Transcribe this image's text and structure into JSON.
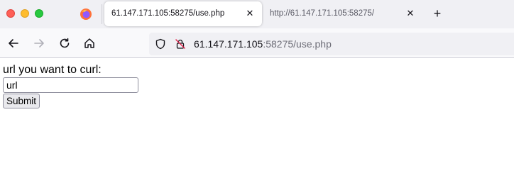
{
  "browser": {
    "tabs": [
      {
        "title": "61.147.171.105:58275/use.php",
        "active": true
      },
      {
        "title": "http://61.147.171.105:58275/",
        "active": false
      }
    ],
    "new_tab_label": "+",
    "close_label": "✕",
    "address": {
      "host": "61.147.171.105",
      "rest": ":58275/use.php"
    }
  },
  "page": {
    "prompt": "url you want to curl:",
    "input_value": "url",
    "submit_label": "Submit"
  },
  "colors": {
    "traffic_close": "#fe5f57",
    "traffic_min": "#febc2e",
    "traffic_max": "#28c840",
    "firefox_orange": "#ff7139",
    "firefox_purple": "#9059ff"
  },
  "icons": [
    "firefox-icon",
    "back-icon",
    "forward-icon",
    "reload-icon",
    "home-icon",
    "shield-icon",
    "insecure-lock-icon",
    "close-icon",
    "plus-icon"
  ]
}
